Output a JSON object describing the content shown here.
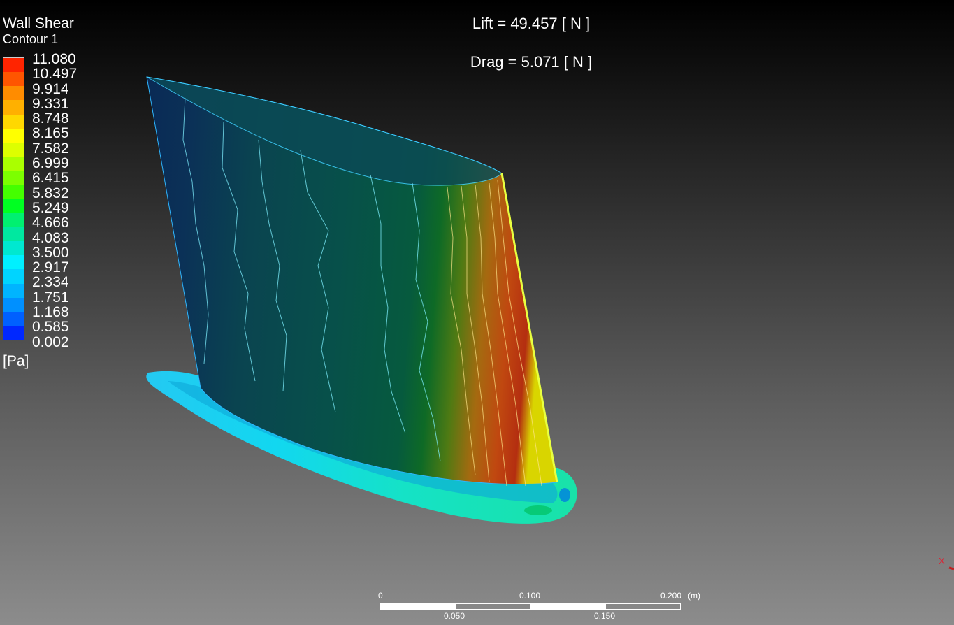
{
  "legend": {
    "title": "Wall Shear",
    "subtitle": "Contour 1",
    "unit": "[Pa]",
    "ticks": [
      "11.080",
      "10.497",
      "9.914",
      "9.331",
      "8.748",
      "8.165",
      "7.582",
      "6.999",
      "6.415",
      "5.832",
      "5.249",
      "4.666",
      "4.083",
      "3.500",
      "2.917",
      "2.334",
      "1.751",
      "1.168",
      "0.585",
      "0.002"
    ],
    "colors": [
      "#ff2400",
      "#ff5500",
      "#ff8c00",
      "#ffb000",
      "#ffd800",
      "#ffff00",
      "#ddff00",
      "#aaff00",
      "#7cff00",
      "#44ff00",
      "#00ff22",
      "#00f070",
      "#00e8a0",
      "#00e8d0",
      "#00f0ff",
      "#00d4ff",
      "#00b4ff",
      "#0090ff",
      "#0060ff",
      "#0028ff"
    ]
  },
  "readouts": {
    "lift": "Lift = 49.457 [ N ]",
    "drag": "Drag = 5.071 [ N ]"
  },
  "scale": {
    "labels_top": [
      "0",
      "0.100",
      "0.200",
      "(m)"
    ],
    "labels_bottom": [
      "0.050",
      "0.150"
    ]
  },
  "axis": {
    "x_label": "X",
    "x_color": "#d02020"
  }
}
